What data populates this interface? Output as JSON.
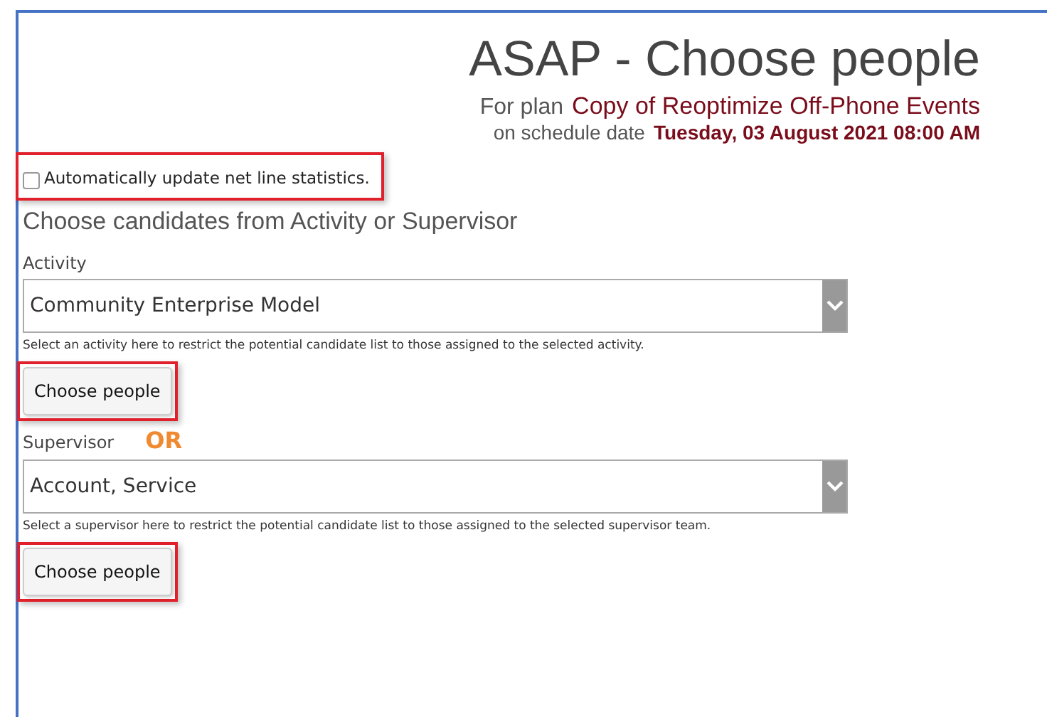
{
  "title": "ASAP - Choose people",
  "plan": {
    "label": "For plan",
    "value": "Copy of Reoptimize Off-Phone Events"
  },
  "schedule": {
    "label": "on schedule date",
    "value": "Tuesday, 03 August 2021 08:00 AM"
  },
  "auto_update": {
    "label": "Automatically update net line statistics.",
    "checked": false,
    "highlighted": true
  },
  "subtitle": "Choose candidates from Activity or Supervisor",
  "sections": [
    {
      "label": "Activity",
      "value": "Community Enterprise Model",
      "hint": "Select an activity here to restrict the potential candidate list to those assigned to the selected activity.",
      "button": "Choose people",
      "highlighted": true
    },
    {
      "label": "Supervisor",
      "callout": "OR",
      "value": "Account, Service",
      "hint": "Select a supervisor here to restrict the potential candidate list to those assigned to the selected supervisor team.",
      "button": "Choose people",
      "highlighted": true
    }
  ]
}
